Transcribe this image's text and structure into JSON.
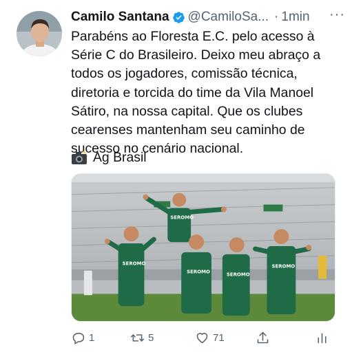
{
  "tweet": {
    "author_name": "Camilo Santana",
    "handle": "@CamiloSa...",
    "time": "1min",
    "more_label": "···",
    "text": "Parabéns ao Floresta E.C. pelo acesso à\nSérie C do Brasileiro. Deixo meu abraço a\ntodos os jogadores, comissão técnica,\ndiretoria e torcida do time da Vila Manoel\nSátiro, na nossa capital. Que os clubes\ncearenses mantenham seu caminho de\nsucesso no cenário nacional.",
    "photo_credit": "Ag Brasil",
    "media_description_icon": "team-celebration-photo",
    "jersey_sponsor": "SEROMO",
    "actions": {
      "reply_count": "1",
      "retweet_count": "5",
      "like_count": "71",
      "share_icon": "share-icon",
      "analytics_icon": "analytics-icon"
    }
  },
  "colors": {
    "text": "#0f1419",
    "secondary": "#536471",
    "verified": "#1d9bf0",
    "jersey": "#1f6b48",
    "pitch": "#5c8a3a"
  }
}
